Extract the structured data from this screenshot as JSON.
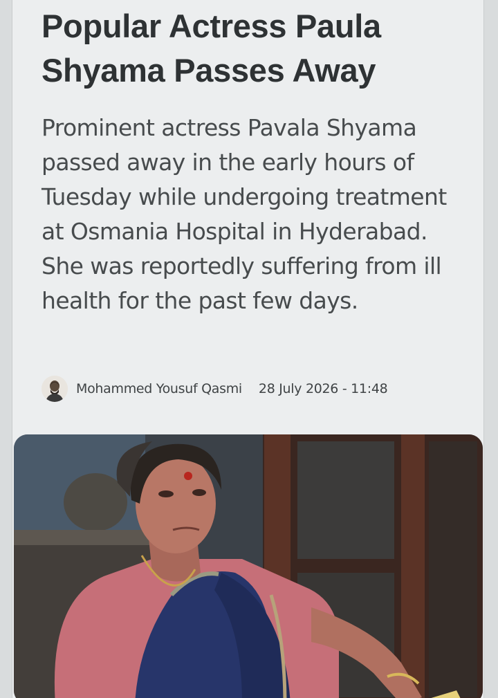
{
  "article": {
    "headline": "Popular Actress Paula Shyama Passes Away",
    "summary": "Prominent actress Pavala Shyama passed away in the early hours of Tuesday while undergoing treatment at Osmania Hospital in Hyderabad. She was reportedly suffering from ill health for the past few days.",
    "author": "Mohammed Yousuf Qasmi",
    "date": "28 July 2026 - 11:48"
  },
  "colors": {
    "page_background": "#eceeef",
    "headline_text": "#2e3234",
    "body_text": "#474b4d"
  }
}
